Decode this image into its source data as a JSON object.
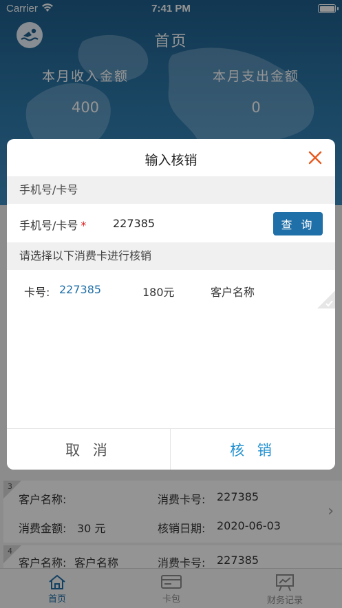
{
  "status_bar": {
    "carrier": "Carrier",
    "time": "7:41 PM"
  },
  "header": {
    "title": "首页",
    "income_label": "本月收入金额",
    "income_value": "400",
    "expense_label": "本月支出金额",
    "expense_value": "0"
  },
  "records": [
    {
      "index": "3",
      "customer_label": "客户名称:",
      "customer_value": "",
      "card_label": "消费卡号:",
      "card_value": "227385",
      "amount_label": "消费金额:",
      "amount_value": "30 元",
      "date_label": "核销日期:",
      "date_value": "2020-06-03"
    },
    {
      "index": "4",
      "customer_label": "客户名称:",
      "customer_value": "客户名称",
      "card_label": "消费卡号:",
      "card_value": "227385"
    }
  ],
  "tabbar": {
    "tabs": [
      {
        "label": "首页",
        "icon": "home-icon",
        "active": true
      },
      {
        "label": "卡包",
        "icon": "card-icon",
        "active": false
      },
      {
        "label": "财务记录",
        "icon": "chart-board-icon",
        "active": false
      }
    ]
  },
  "modal": {
    "title": "输入核销",
    "section1": "手机号/卡号",
    "field_label": "手机号/卡号",
    "field_required": "*",
    "field_value": "227385",
    "query_button": "查 询",
    "section2": "请选择以下消费卡进行核销",
    "card": {
      "no_label": "卡号:",
      "no_value": "227385",
      "amount": "180元",
      "customer": "客户名称"
    },
    "cancel_button": "取 消",
    "confirm_button": "核 销"
  },
  "colors": {
    "accent": "#1f6fa8",
    "close": "#e8581c",
    "required": "#e02020",
    "confirm_text": "#1f8fd0"
  }
}
